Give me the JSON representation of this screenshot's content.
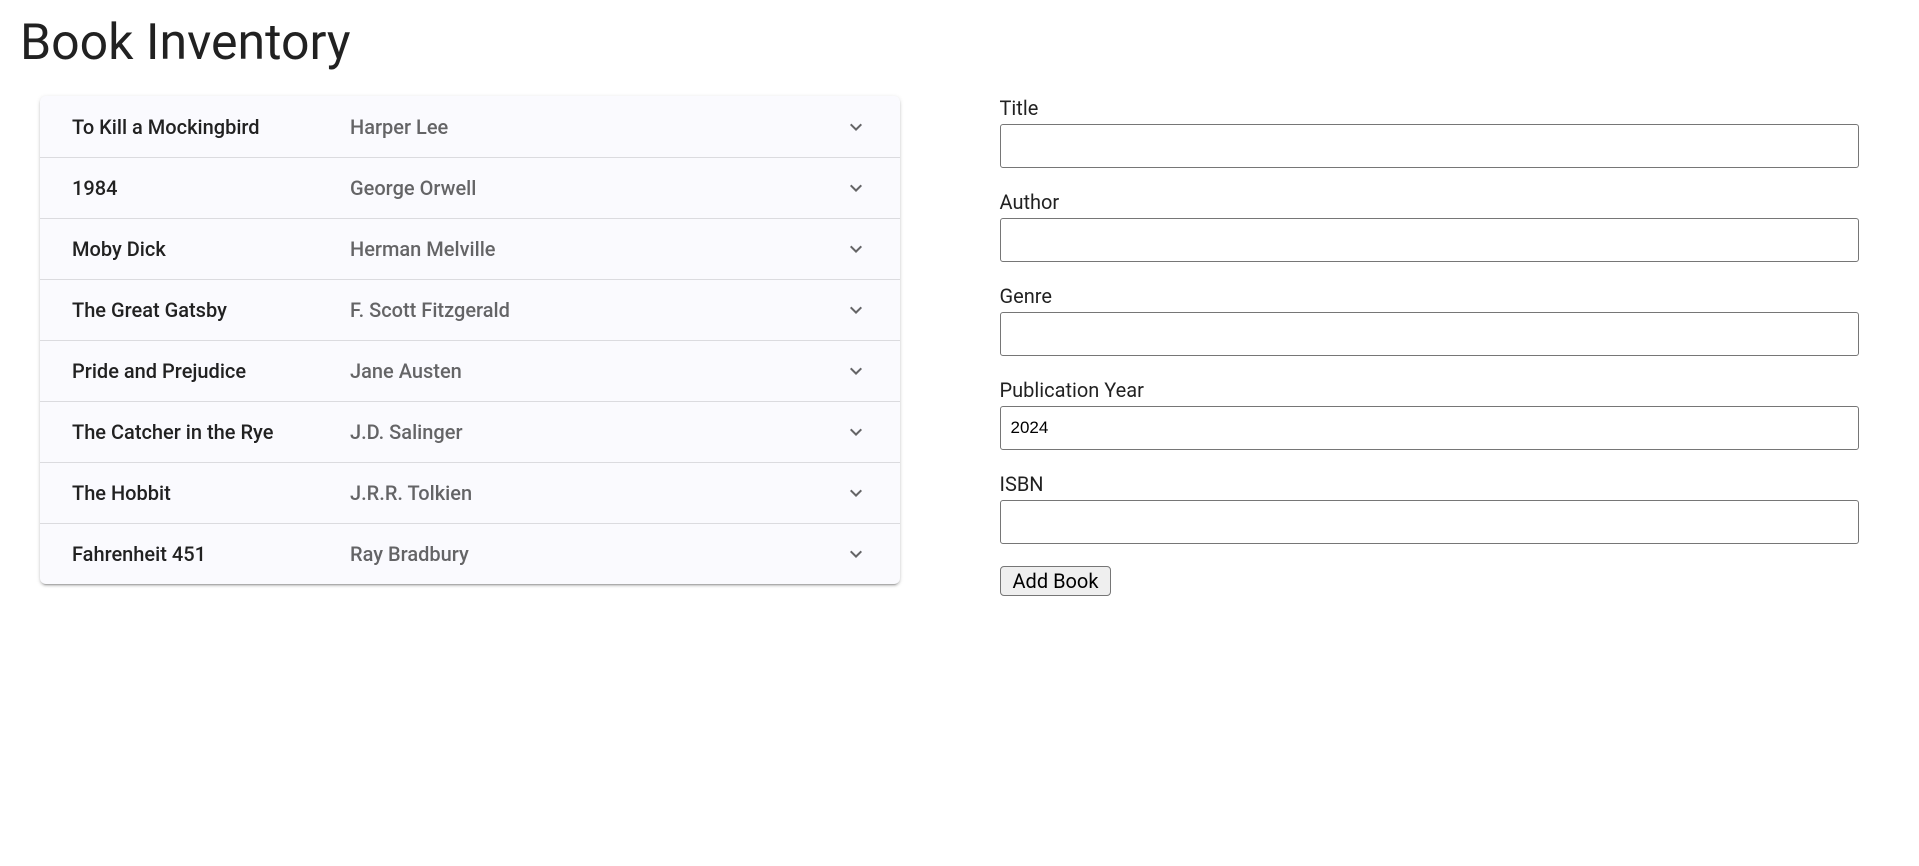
{
  "page": {
    "title": "Book Inventory"
  },
  "books": [
    {
      "title": "To Kill a Mockingbird",
      "author": "Harper Lee"
    },
    {
      "title": "1984",
      "author": "George Orwell"
    },
    {
      "title": "Moby Dick",
      "author": "Herman Melville"
    },
    {
      "title": "The Great Gatsby",
      "author": "F. Scott Fitzgerald"
    },
    {
      "title": "Pride and Prejudice",
      "author": "Jane Austen"
    },
    {
      "title": "The Catcher in the Rye",
      "author": "J.D. Salinger"
    },
    {
      "title": "The Hobbit",
      "author": "J.R.R. Tolkien"
    },
    {
      "title": "Fahrenheit 451",
      "author": "Ray Bradbury"
    }
  ],
  "form": {
    "title_label": "Title",
    "title_value": "",
    "author_label": "Author",
    "author_value": "",
    "genre_label": "Genre",
    "genre_value": "",
    "year_label": "Publication Year",
    "year_value": "2024",
    "isbn_label": "ISBN",
    "isbn_value": "",
    "submit_label": "Add Book"
  }
}
